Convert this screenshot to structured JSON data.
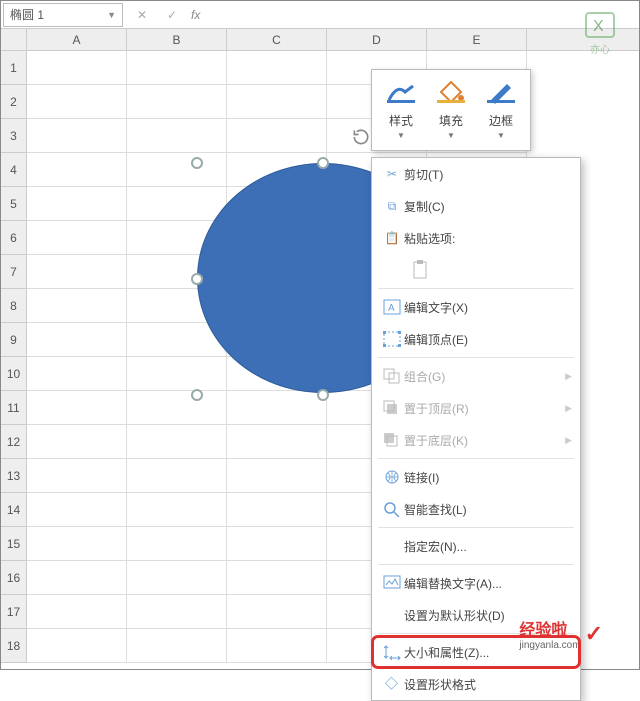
{
  "namebox": {
    "value": "椭圆 1"
  },
  "formula_bar": {
    "cancel": "✕",
    "confirm": "✓",
    "fx": "fx",
    "value": ""
  },
  "columns": [
    "A",
    "B",
    "C",
    "D",
    "E"
  ],
  "rows": [
    "1",
    "2",
    "3",
    "4",
    "5",
    "6",
    "7",
    "8",
    "9",
    "10",
    "11",
    "12",
    "13",
    "14",
    "15",
    "16",
    "17",
    "18"
  ],
  "mini_toolbar": {
    "style": "样式",
    "fill": "填充",
    "border": "边框"
  },
  "context_menu": {
    "cut": "剪切(T)",
    "copy": "复制(C)",
    "paste_options": "粘贴选项:",
    "edit_text": "编辑文字(X)",
    "edit_points": "编辑顶点(E)",
    "group": "组合(G)",
    "bring_front": "置于顶层(R)",
    "send_back": "置于底层(K)",
    "link": "链接(I)",
    "smart_lookup": "智能查找(L)",
    "assign_macro": "指定宏(N)...",
    "alt_text": "编辑替换文字(A)...",
    "set_default": "设置为默认形状(D)",
    "size_properties": "大小和属性(Z)...",
    "format_shape": "设置形状格式"
  },
  "watermark": {
    "brand_top": "亦心",
    "brand_icon": "X",
    "brand_bottom": "经验啦",
    "brand_url": "jingyanla.com"
  }
}
